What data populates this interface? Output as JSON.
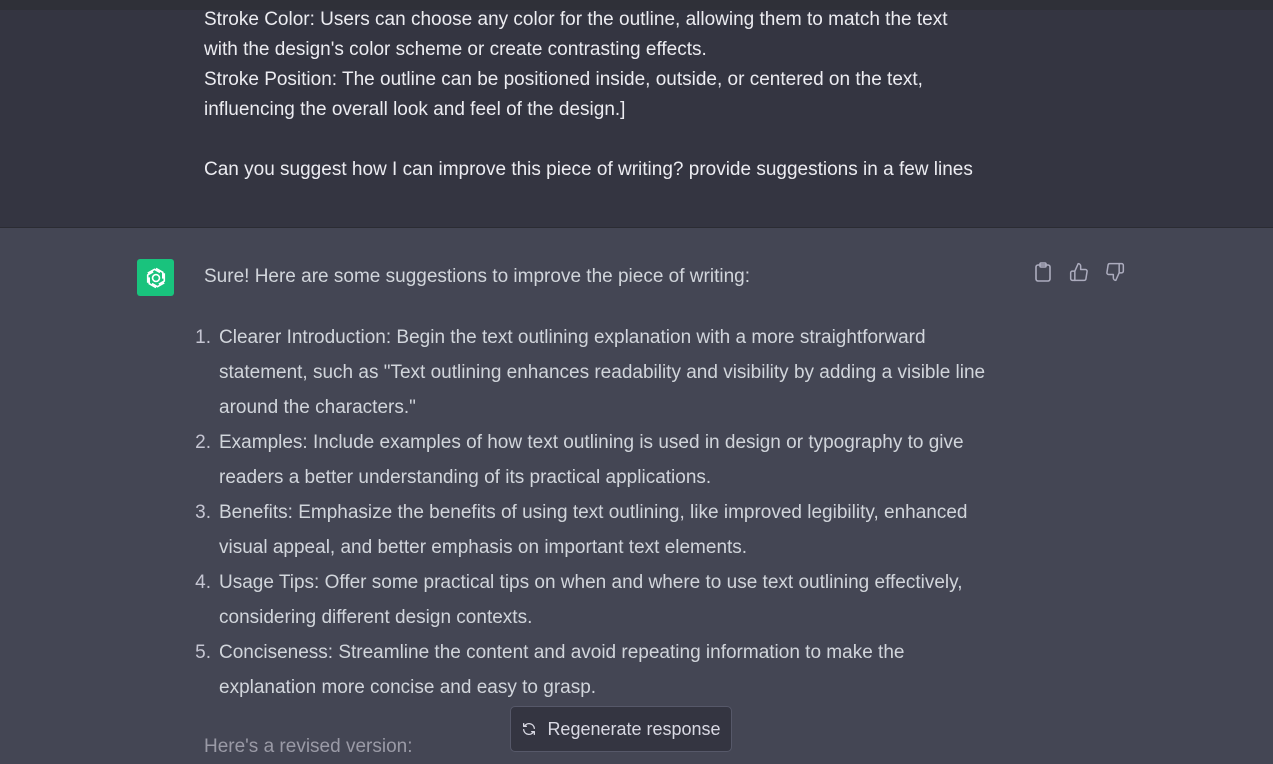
{
  "user_message": {
    "lines": [
      "Stroke Color: Users can choose any color for the outline, allowing them to match the text",
      "with the design's color scheme or create contrasting effects.",
      "Stroke Position: The outline can be positioned inside, outside, or centered on the text,",
      "influencing the overall look and feel of the design.]"
    ],
    "question": "Can you suggest how I can improve this piece of writing? provide suggestions in a few lines"
  },
  "assistant": {
    "avatar_icon": "openai-logo-icon",
    "intro": "Sure! Here are some suggestions to improve the piece of writing:",
    "actions": {
      "copy_icon": "clipboard-icon",
      "like_icon": "thumbs-up-icon",
      "dislike_icon": "thumbs-down-icon"
    },
    "suggestions": [
      {
        "number": "1.",
        "lines": [
          "Clearer Introduction: Begin the text outlining explanation with a more straightforward",
          "statement, such as \"Text outlining enhances readability and visibility by adding a visible line",
          "around the characters.\""
        ]
      },
      {
        "number": "2.",
        "lines": [
          "Examples: Include examples of how text outlining is used in design or typography to give",
          "readers a better understanding of its practical applications."
        ]
      },
      {
        "number": "3.",
        "lines": [
          "Benefits: Emphasize the benefits of using text outlining, like improved legibility, enhanced",
          "visual appeal, and better emphasis on important text elements."
        ]
      },
      {
        "number": "4.",
        "lines": [
          "Usage Tips: Offer some practical tips on when and where to use text outlining effectively,",
          "considering different design contexts."
        ]
      },
      {
        "number": "5.",
        "lines": [
          "Conciseness: Streamline the content and avoid repeating information to make the",
          "explanation more concise and easy to grasp."
        ]
      }
    ],
    "revised_label": "Here's a revised version:"
  },
  "regenerate": {
    "label": "Regenerate response",
    "icon": "refresh-icon"
  },
  "colors": {
    "user_bg": "#343541",
    "assistant_bg": "#444654",
    "accent": "#19c37d"
  }
}
